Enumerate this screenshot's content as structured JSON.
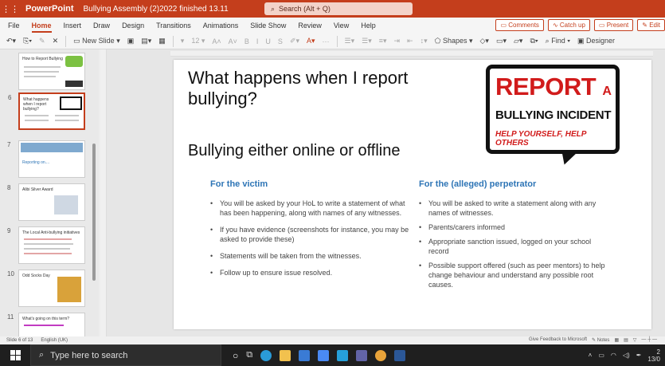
{
  "titlebar": {
    "app_name": "PowerPoint",
    "doc_name": "Bullying Assembly (2)2022 finished 13.11",
    "search_placeholder": "Search (Alt + Q)"
  },
  "menu": {
    "tabs": [
      "File",
      "Home",
      "Insert",
      "Draw",
      "Design",
      "Transitions",
      "Animations",
      "Slide Show",
      "Review",
      "View",
      "Help"
    ],
    "active_tab": "Home",
    "comments_label": "Comments",
    "catchup_label": "Catch up",
    "present_label": "Present",
    "edit_label": "Edit"
  },
  "ribbon": {
    "new_slide_label": "New Slide",
    "font_size": "12",
    "shapes_label": "Shapes",
    "find_label": "Find",
    "designer_label": "Designer"
  },
  "thumbnails": [
    {
      "num": "",
      "title": "How to Report Bullying"
    },
    {
      "num": "6",
      "title": "What happens when I report bullying?"
    },
    {
      "num": "7",
      "title": "Reporting on...."
    },
    {
      "num": "8",
      "title": "Alibi Silver Award"
    },
    {
      "num": "9",
      "title": "The Local Anti-bullying initiatives"
    },
    {
      "num": "10",
      "title": "Odd Socks Day"
    },
    {
      "num": "11",
      "title": "What's going on this term?"
    }
  ],
  "slide": {
    "title": "What happens when I report bullying?",
    "subtitle": "Bullying either online or offline",
    "badge": {
      "line1_big": "REPORT",
      "line1_small": "A",
      "line2": "BULLYING INCIDENT",
      "line3": "HELP YOURSELF, HELP OTHERS"
    },
    "victim": {
      "heading": "For the victim",
      "items": [
        "You will be asked by your HoL to write a statement of what has been happening, along with names of any witnesses.",
        "If you have evidence (screenshots for instance, you may be asked to provide these)",
        "Statements will be taken from the witnesses.",
        "Follow up to ensure issue resolved."
      ]
    },
    "perpetrator": {
      "heading": "For the (alleged) perpetrator",
      "items": [
        "You will be asked to write a statement along with any names of witnesses.",
        "Parents/carers informed",
        "Appropriate sanction issued, logged on your school record",
        "Possible support offered (such as peer mentors) to help change behaviour and understand any possible root causes."
      ]
    }
  },
  "status": {
    "slide_info": "Slide 6 of 13",
    "language": "English (UK)",
    "feedback": "Give Feedback to Microsoft",
    "notes": "Notes"
  },
  "taskbar": {
    "search_placeholder": "Type here to search",
    "clock_time": "2",
    "clock_date": "13/0"
  }
}
